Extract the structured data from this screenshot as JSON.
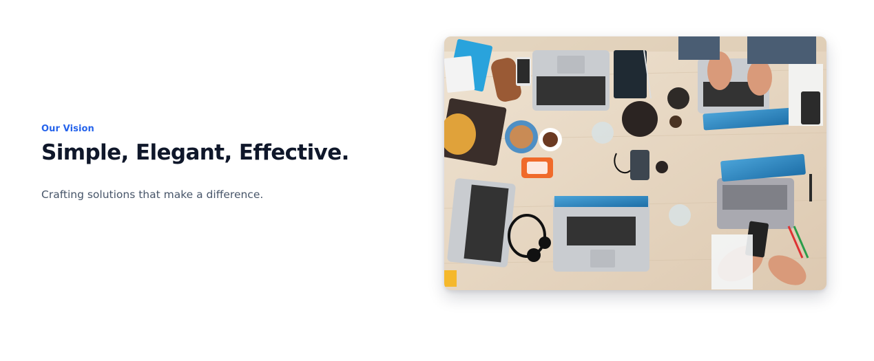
{
  "vision": {
    "eyebrow": "Our Vision",
    "headline": "Simple, Elegant, Effective.",
    "subtext": "Crafting solutions that make a difference."
  },
  "photo": {
    "subject": "overhead-desk-with-laptops"
  },
  "colors": {
    "accent": "#2563eb",
    "heading": "#0f172a",
    "body_text": "#475569",
    "background": "#ffffff"
  }
}
